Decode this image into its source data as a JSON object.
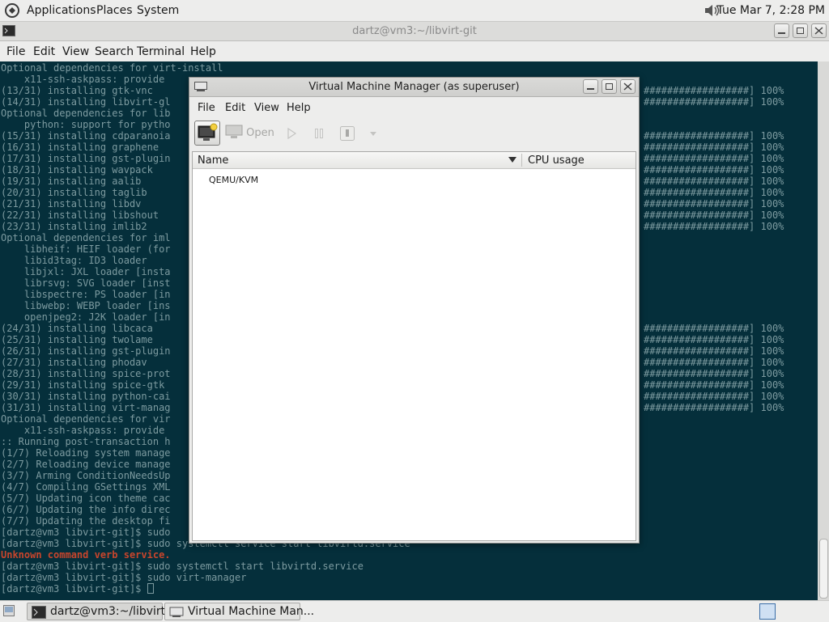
{
  "top_panel": {
    "menus": [
      "Applications",
      "Places",
      "System"
    ],
    "clock": "Tue Mar 7, 2:28 PM"
  },
  "terminal": {
    "title": "dartz@vm3:~/libvirt-git",
    "menus": [
      "File",
      "Edit",
      "View",
      "Search",
      "Terminal",
      "Help"
    ],
    "lines": [
      "Optional dependencies for virt-install",
      "    x11-ssh-askpass: provide",
      "(13/31) installing gtk-vnc",
      "(14/31) installing libvirt-gl",
      "Optional dependencies for lib",
      "    python: support for pytho",
      "(15/31) installing cdparanoia",
      "(16/31) installing graphene",
      "(17/31) installing gst-plugin",
      "(18/31) installing wavpack",
      "(19/31) installing aalib",
      "(20/31) installing taglib",
      "(21/31) installing libdv",
      "(22/31) installing libshout",
      "(23/31) installing imlib2",
      "Optional dependencies for iml",
      "    libheif: HEIF loader (for",
      "    libid3tag: ID3 loader",
      "    libjxl: JXL loader [insta",
      "    librsvg: SVG loader [inst",
      "    libspectre: PS loader [in",
      "    libwebp: WEBP loader [ins",
      "    openjpeg2: J2K loader [in",
      "(24/31) installing libcaca",
      "(25/31) installing twolame",
      "(26/31) installing gst-plugin",
      "(27/31) installing phodav",
      "(28/31) installing spice-prot",
      "(29/31) installing spice-gtk",
      "(30/31) installing python-cai",
      "(31/31) installing virt-manag",
      "Optional dependencies for vir",
      "    x11-ssh-askpass: provide",
      ":: Running post-transaction h",
      "(1/7) Reloading system manage",
      "(2/7) Reloading device manage",
      "(3/7) Arming ConditionNeedsUp",
      "(4/7) Compiling GSettings XML",
      "(5/7) Updating icon theme cac",
      "(6/7) Updating the info direc",
      "(7/7) Updating the desktop fi",
      "[dartz@vm3 libvirt-git]$ sudo",
      "[dartz@vm3 libvirt-git]$ sudo systemctl service start libvirtd.service"
    ],
    "error_line": "Unknown command verb service.",
    "after_lines": [
      "[dartz@vm3 libvirt-git]$ sudo systemctl start libvirtd.service",
      "[dartz@vm3 libvirt-git]$ sudo virt-manager",
      "[dartz@vm3 libvirt-git]$ "
    ],
    "progress_text": "##################] 100%"
  },
  "vmm": {
    "title": "Virtual Machine Manager (as superuser)",
    "menus": [
      "File",
      "Edit",
      "View",
      "Help"
    ],
    "open_label": "Open",
    "columns": [
      "Name",
      "CPU usage"
    ],
    "connections": [
      "QEMU/KVM"
    ]
  },
  "taskbar": {
    "tasks": [
      "dartz@vm3:~/libvirt...",
      "Virtual Machine Man..."
    ]
  }
}
